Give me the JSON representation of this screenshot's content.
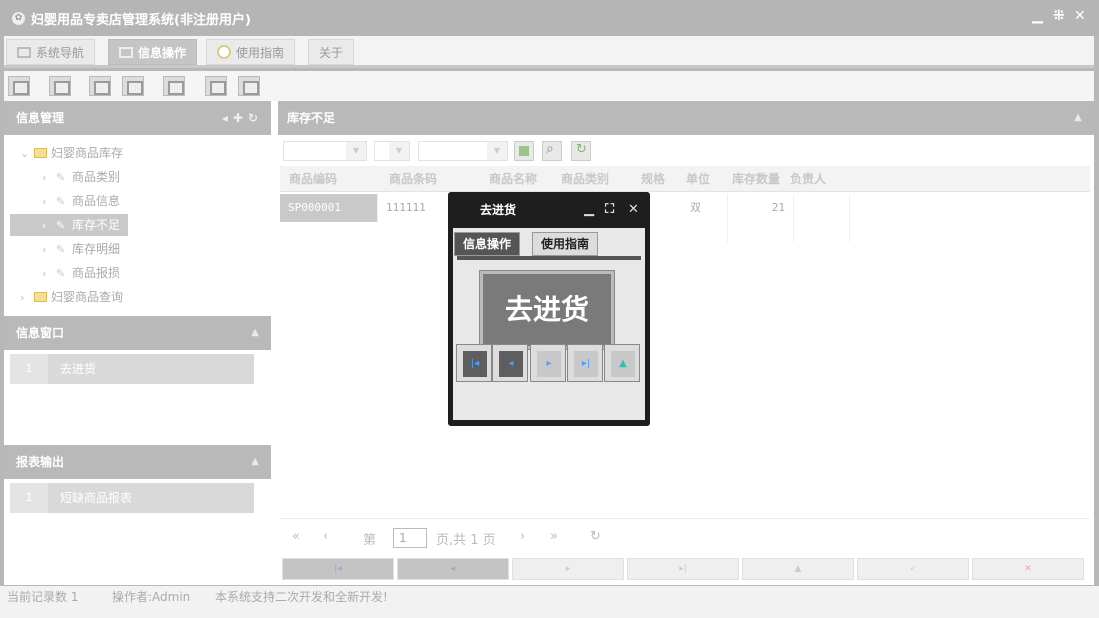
{
  "window": {
    "title": "妇婴用品专卖店管理系统(非注册用户)",
    "controls": [
      "minimize",
      "restore",
      "close"
    ]
  },
  "tabs": [
    {
      "label": "系统导航",
      "icon": "monitor-icon",
      "active": false
    },
    {
      "label": "信息操作",
      "icon": "grid-icon",
      "active": true
    },
    {
      "label": "使用指南",
      "icon": "help-icon",
      "active": false
    },
    {
      "label": "关于",
      "icon": "",
      "active": false
    }
  ],
  "toolbar": {
    "icons": [
      "search-tool-icon",
      "list-tool-icon",
      "document-tool-icon",
      "users-tool-icon",
      "window-tool-icon",
      "form-tool-icon",
      "print-tool-icon"
    ]
  },
  "info_panel": {
    "title": "信息管理",
    "tree": [
      {
        "label": "妇婴商品库存",
        "type": "folder",
        "expanded": true
      },
      {
        "label": "商品类别",
        "type": "leaf"
      },
      {
        "label": "商品信息",
        "type": "leaf"
      },
      {
        "label": "库存不足",
        "type": "leaf",
        "selected": true
      },
      {
        "label": "库存明细",
        "type": "leaf"
      },
      {
        "label": "商品报损",
        "type": "leaf"
      },
      {
        "label": "妇婴商品查询",
        "type": "folder",
        "expanded": false
      }
    ]
  },
  "window_panel": {
    "title": "信息窗口",
    "items": [
      {
        "num": "1",
        "label": "去进货"
      }
    ]
  },
  "report_panel": {
    "title": "报表输出",
    "items": [
      {
        "num": "1",
        "label": "短缺商品报表"
      }
    ]
  },
  "grid": {
    "title": "库存不足",
    "columns": [
      "商品编码",
      "商品条码",
      "商品名称",
      "商品类别",
      "规格",
      "单位",
      "库存数量",
      "负责人"
    ],
    "rows": [
      {
        "code": "SP000001",
        "barcode": "111111",
        "unit": "双",
        "qty": "21"
      }
    ]
  },
  "pager": {
    "page_prefix": "第",
    "page_value": "1",
    "page_suffix": "页,共 1 页"
  },
  "statusbar": {
    "records": "当前记录数 1",
    "operator": "操作者:Admin",
    "note": "本系统支持二次开发和全新开发!"
  },
  "dialog": {
    "title": "去进货",
    "tabs": [
      "信息操作",
      "使用指南"
    ],
    "button": "去进货"
  }
}
